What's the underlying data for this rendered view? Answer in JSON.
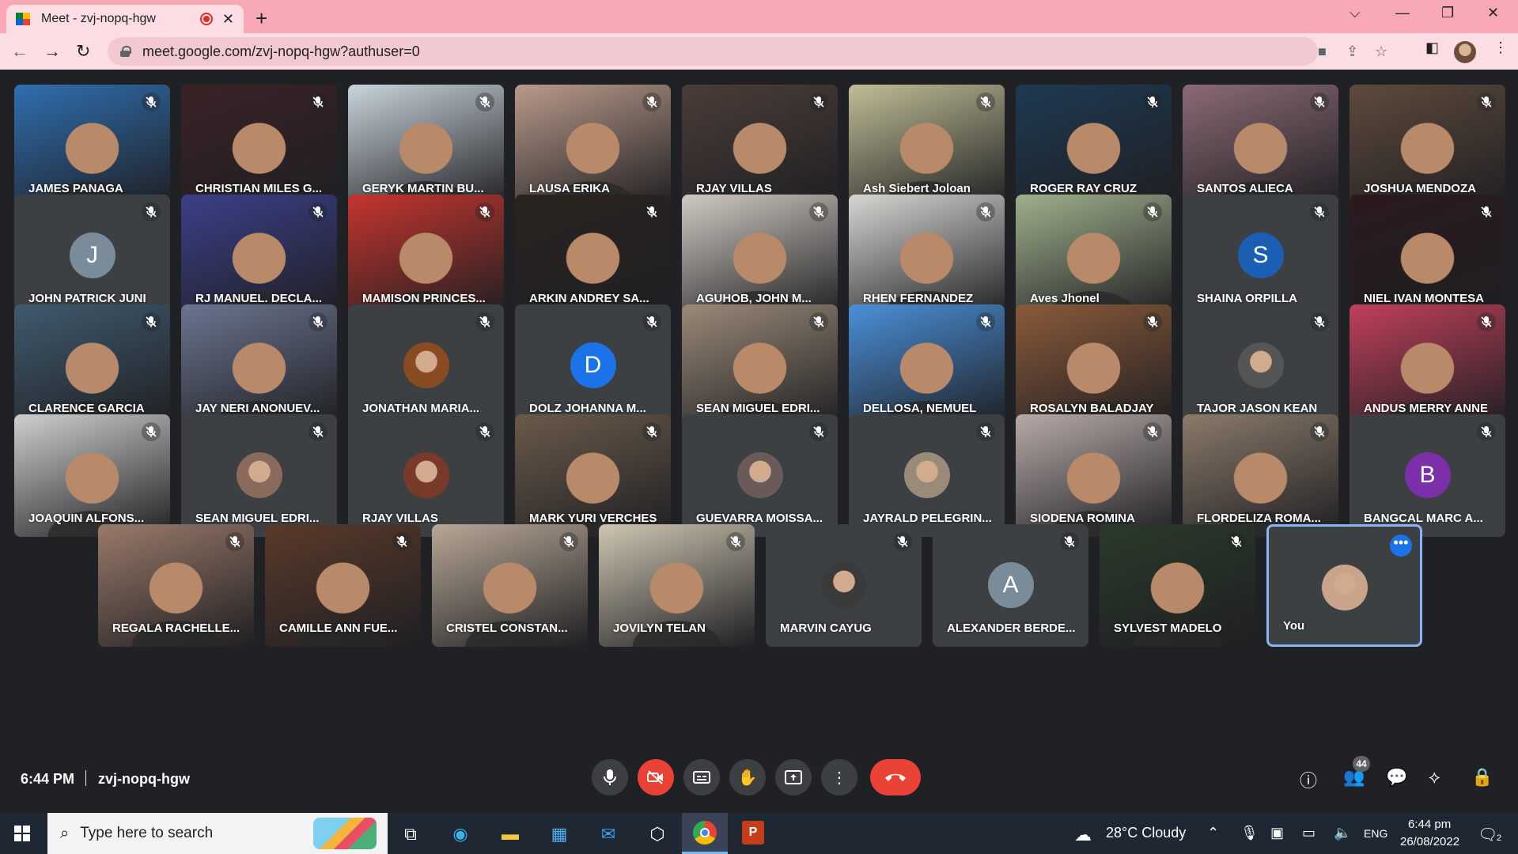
{
  "browser": {
    "tab_title": "Meet - zvj-nopq-hgw",
    "tab_close": "✕",
    "new_tab": "+",
    "url": "meet.google.com/zvj-nopq-hgw?authuser=0",
    "window_controls": {
      "tablist": "⌵",
      "minimize": "—",
      "restore": "❐",
      "close": "✕"
    },
    "nav": {
      "back": "←",
      "forward": "→",
      "reload": "↻"
    }
  },
  "participants": [
    {
      "name": "JAMES PANAGA",
      "tile": "video",
      "bg": "#2f6fb0"
    },
    {
      "name": "CHRISTIAN MILES G...",
      "tile": "video",
      "bg": "#3a2226"
    },
    {
      "name": "GERYK MARTIN BU...",
      "tile": "video",
      "bg": "#c9d4dc"
    },
    {
      "name": "LAUSA ERIKA",
      "tile": "video",
      "bg": "#b99a8a"
    },
    {
      "name": "RJAY VILLAS",
      "tile": "video",
      "bg": "#4b3d38"
    },
    {
      "name": "Ash Siebert Joloan",
      "tile": "video",
      "bg": "#c0bd96"
    },
    {
      "name": "ROGER RAY CRUZ",
      "tile": "video",
      "bg": "#1e3a52"
    },
    {
      "name": "SANTOS ALIECA",
      "tile": "video",
      "bg": "#8b6a76"
    },
    {
      "name": "JOSHUA MENDOZA",
      "tile": "video",
      "bg": "#5e4a3c"
    },
    {
      "name": "JOHN PATRICK JUNI",
      "tile": "avatar",
      "initial": "J",
      "avatar_color": "#7a8c9a"
    },
    {
      "name": "RJ MANUEL. DECLA...",
      "tile": "video",
      "bg": "#3b3f88"
    },
    {
      "name": "MAMISON PRINCES...",
      "tile": "video",
      "bg": "#c5352e"
    },
    {
      "name": "ARKIN ANDREY SA...",
      "tile": "video",
      "bg": "#2b2420"
    },
    {
      "name": "AGUHOB, JOHN M...",
      "tile": "video",
      "bg": "#cfcac2"
    },
    {
      "name": "RHEN FERNANDEZ",
      "tile": "video",
      "bg": "#d8d6d2"
    },
    {
      "name": "Aves Jhonel",
      "tile": "video",
      "bg": "#9fb08c"
    },
    {
      "name": "SHAINA ORPILLA",
      "tile": "avatar",
      "initial": "S",
      "avatar_color": "#1a5fb4"
    },
    {
      "name": "NIEL IVAN MONTESA",
      "tile": "video",
      "bg": "#2b1a1e"
    },
    {
      "name": "CLARENCE GARCIA",
      "tile": "video",
      "bg": "#3f5a6e"
    },
    {
      "name": "JAY NERI ANONUEV...",
      "tile": "video",
      "bg": "#6b7590"
    },
    {
      "name": "JONATHAN MARIA...",
      "tile": "photo",
      "avatar_color": "#8a4a22"
    },
    {
      "name": "DOLZ JOHANNA M...",
      "tile": "avatar",
      "initial": "D",
      "avatar_color": "#1a73e8"
    },
    {
      "name": "SEAN MIGUEL EDRI...",
      "tile": "video",
      "bg": "#9a8a78"
    },
    {
      "name": "DELLOSA, NEMUEL",
      "tile": "video",
      "bg": "#4a90d9"
    },
    {
      "name": "ROSALYN BALADJAY",
      "tile": "video",
      "bg": "#8a5a3a"
    },
    {
      "name": "TAJOR JASON KEAN",
      "tile": "photo",
      "avatar_color": "#555555"
    },
    {
      "name": "ANDUS MERRY ANNE",
      "tile": "video",
      "bg": "#c0405a"
    },
    {
      "name": "JOAQUIN ALFONS...",
      "tile": "video",
      "bg": "#cfcfcf"
    },
    {
      "name": "SEAN MIGUEL EDRI...",
      "tile": "photo",
      "avatar_color": "#8a6a5a"
    },
    {
      "name": "RJAY VILLAS",
      "tile": "photo",
      "avatar_color": "#7a3a2a"
    },
    {
      "name": "MARK YURI VERCHES",
      "tile": "video",
      "bg": "#6a5a4a"
    },
    {
      "name": "GUEVARRA MOISSA...",
      "tile": "photo",
      "avatar_color": "#6a5a5a"
    },
    {
      "name": "JAYRALD PELEGRIN...",
      "tile": "photo",
      "avatar_color": "#9a8a7a"
    },
    {
      "name": "SIODENA ROMINA",
      "tile": "video",
      "bg": "#b7aaa8"
    },
    {
      "name": "FLORDELIZA ROMA...",
      "tile": "video",
      "bg": "#8a7a6a"
    },
    {
      "name": "BANGCAL MARC A...",
      "tile": "avatar",
      "initial": "B",
      "avatar_color": "#7b2fa8"
    },
    {
      "name": "REGALA RACHELLE...",
      "tile": "video",
      "bg": "#9a7a6a"
    },
    {
      "name": "CAMILLE ANN FUE...",
      "tile": "video",
      "bg": "#5a3a2a"
    },
    {
      "name": "CRISTEL CONSTAN...",
      "tile": "video",
      "bg": "#b8a896"
    },
    {
      "name": "JOVILYN TELAN",
      "tile": "video",
      "bg": "#cfc6b2"
    },
    {
      "name": "MARVIN CAYUG",
      "tile": "photo",
      "avatar_color": "#3a3a3a"
    },
    {
      "name": "ALEXANDER BERDE...",
      "tile": "avatar",
      "initial": "A",
      "avatar_color": "#7a8c9a"
    },
    {
      "name": "SYLVEST MADELO",
      "tile": "video",
      "bg": "#2a3a2a"
    },
    {
      "name": "You",
      "tile": "self",
      "avatar_color": "#c9a48a"
    }
  ],
  "meeting": {
    "time": "6:44 PM",
    "code": "zvj-nopq-hgw",
    "participant_count": "44",
    "accent": "#8ab4f8",
    "danger": "#ea4335"
  },
  "taskbar": {
    "search_placeholder": "Type here to search",
    "weather": "28°C  Cloudy",
    "language": "ENG",
    "time": "6:44 pm",
    "date": "26/08/2022",
    "notifications": "2"
  }
}
